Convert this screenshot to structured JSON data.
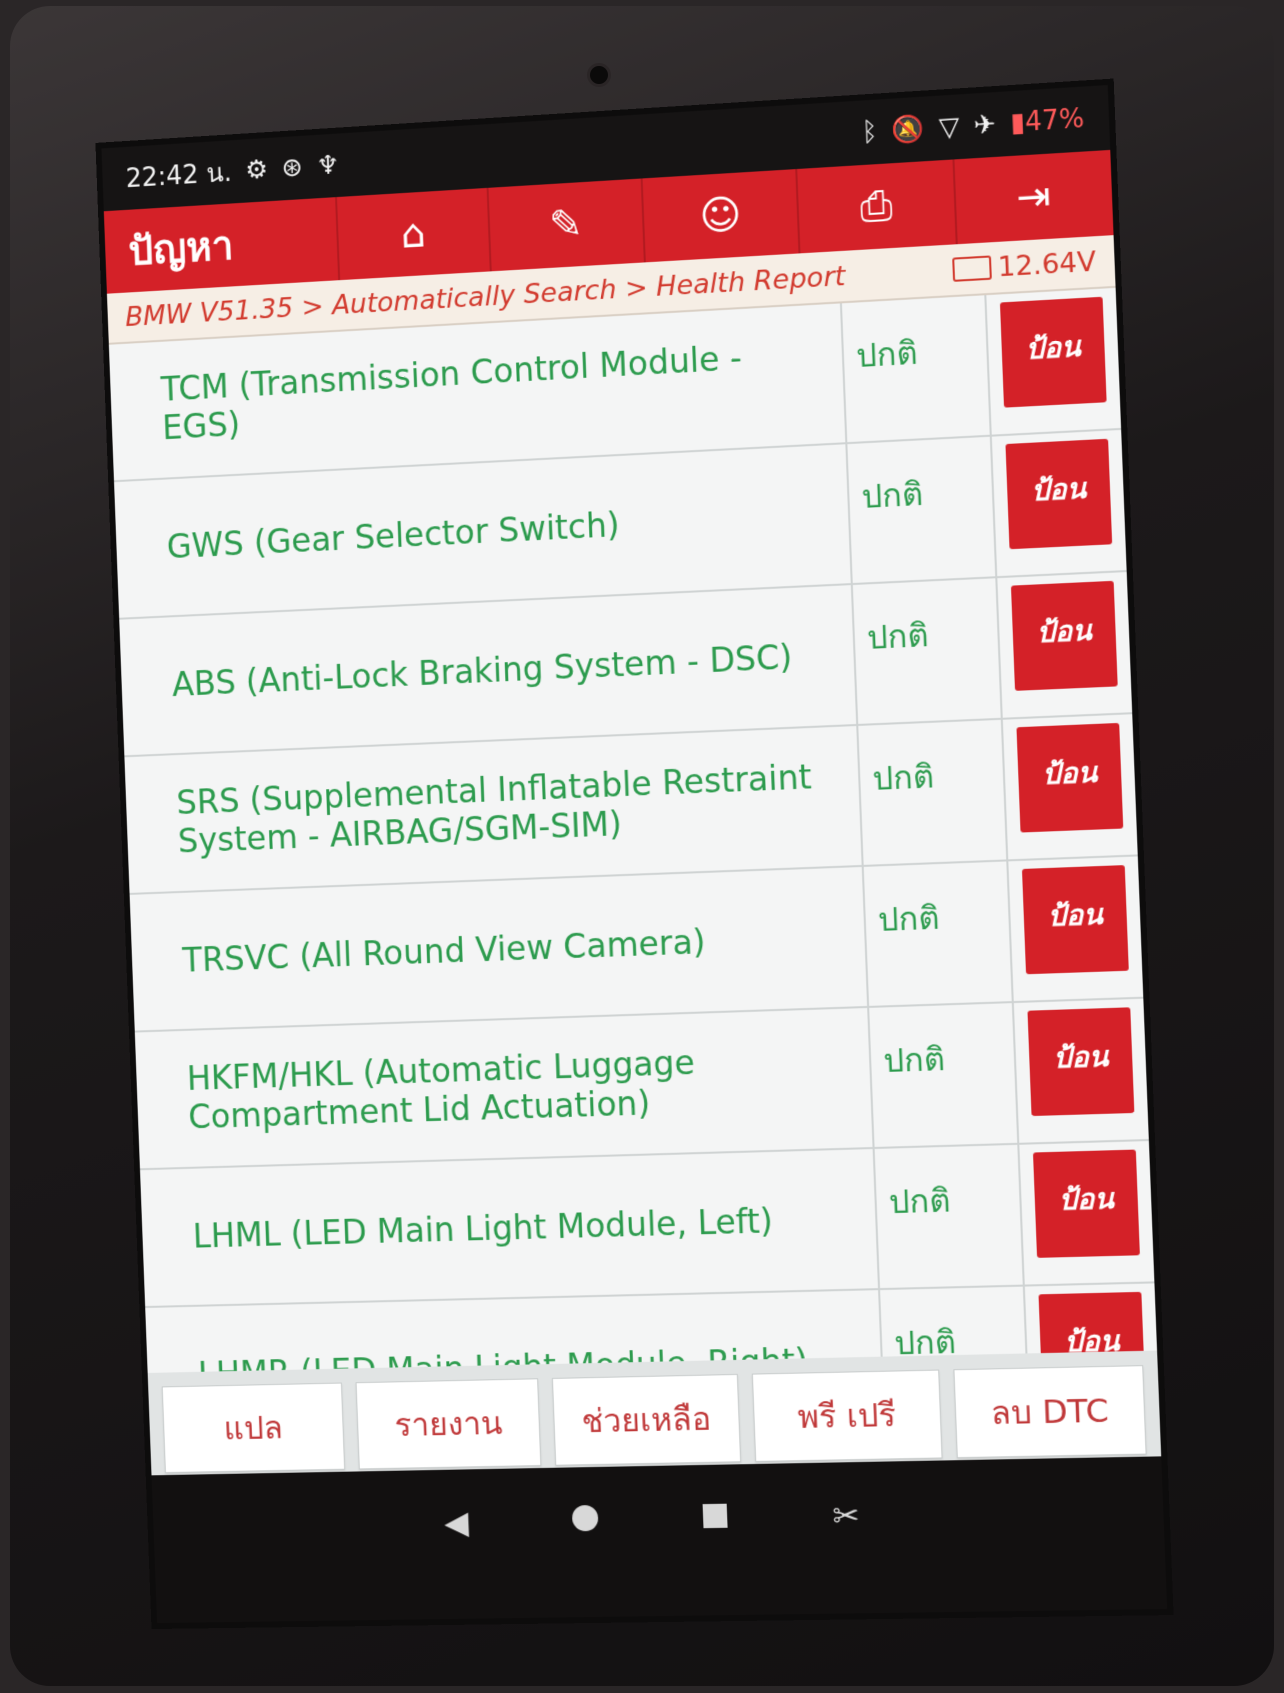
{
  "status_bar": {
    "time": "22:42 น.",
    "left_icons": [
      "settings-icon",
      "accessibility-icon",
      "stethoscope-icon"
    ],
    "right_icons": [
      "bluetooth-icon",
      "mute-icon",
      "wifi-icon",
      "airplane-icon"
    ],
    "battery": "47%"
  },
  "toolbar": {
    "title": "ปัญหา",
    "buttons": [
      "home-icon",
      "edit-icon",
      "support-icon",
      "print-icon",
      "exit-icon"
    ]
  },
  "breadcrumb": "BMW V51.35 > Automatically Search > Health Report",
  "voltage": "12.64V",
  "modules": [
    {
      "name": "TCM (Transmission Control Module - EGS)",
      "status": "ปกติ",
      "action": "ป้อน"
    },
    {
      "name": "GWS (Gear Selector Switch)",
      "status": "ปกติ",
      "action": "ป้อน"
    },
    {
      "name": "ABS (Anti-Lock Braking System - DSC)",
      "status": "ปกติ",
      "action": "ป้อน"
    },
    {
      "name": "SRS (Supplemental Inflatable Restraint System - AIRBAG/SGM-SIM)",
      "status": "ปกติ",
      "action": "ป้อน"
    },
    {
      "name": "TRSVC (All Round View Camera)",
      "status": "ปกติ",
      "action": "ป้อน"
    },
    {
      "name": "HKFM/HKL (Automatic Luggage Compartment Lid Actuation)",
      "status": "ปกติ",
      "action": "ป้อน"
    },
    {
      "name": "LHML (LED Main Light Module, Left)",
      "status": "ปกติ",
      "action": "ป้อน"
    },
    {
      "name": "LHMR (LED Main Light Module, Right)",
      "status": "ปกติ",
      "action": "ป้อน"
    }
  ],
  "bottom_buttons": [
    "แปล",
    "รายงาน",
    "ช่วยเหลือ",
    "พรี เปรี",
    "ลบ DTC"
  ],
  "nav": [
    "back-icon",
    "home-icon",
    "recents-icon",
    "screenshot-icon"
  ],
  "colors": {
    "brand_red": "#d42128",
    "ok_green": "#2c9b4d"
  }
}
